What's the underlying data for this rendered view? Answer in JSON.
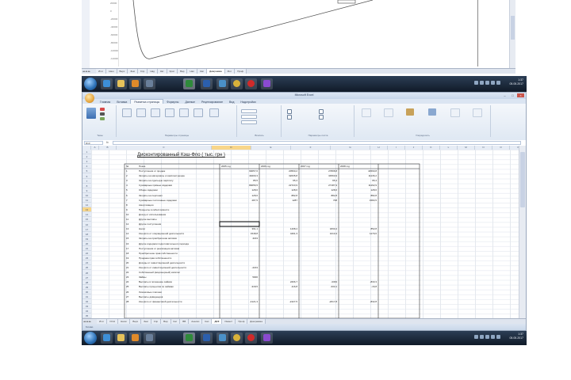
{
  "top_window": {
    "y_axis_labels": [
      "20000",
      "0",
      "-20000",
      "-40000",
      "-60000",
      "-80000",
      "-100000",
      "-120000"
    ],
    "tabs": [
      "Итог",
      "Наш",
      "Верх",
      "Зем",
      "Спр",
      "Над",
      "Кат",
      "Крат",
      "Вар",
      "Нал",
      "Кап",
      "Диаграмма",
      "Мот",
      "Проф"
    ],
    "active_tab": "Диаграмма"
  },
  "window": {
    "title": "Microsoft Excel",
    "menu_tabs": [
      "Главная",
      "Вставка",
      "Разметка страницы",
      "Формулы",
      "Данные",
      "Рецензирование",
      "Вид",
      "Надстройки"
    ],
    "active_menu_tab": "Разметка страницы",
    "ribbon_groups": [
      "Темы",
      "Параметры страницы",
      "Вписать",
      "Параметры листа",
      "Упорядочить"
    ],
    "name_box": "D13",
    "fx": "fx",
    "column_headers": [
      "A",
      "B",
      "C",
      "D",
      "E",
      "F",
      "G",
      "H",
      "I",
      "J",
      "K",
      "L",
      "M",
      "N",
      "O",
      "P"
    ],
    "sheet_title": "Дисконтированный Кэш-Фло ( тыс. грн )",
    "year_headers": [
      "2005 год",
      "2006 год",
      "2007 год",
      "2008 год"
    ],
    "rows": [
      {
        "n": "1",
        "label": "Поступления от продаж",
        "v": [
          "99057,6",
          "20560,2",
          "27808,8",
          "44590,8"
        ]
      },
      {
        "n": "2",
        "label": "Затраты на материалы и комплектующие",
        "v": [
          "49200,3",
          "32635,8",
          "34560,9",
          "11136,2"
        ]
      },
      {
        "n": "3",
        "label": "Затраты на сдельную зарплату",
        "v": [
          "85,5",
          "95,4",
          "95,4",
          "95,4"
        ]
      },
      {
        "n": "4",
        "label": "Суммарные прямые издержки",
        "v": [
          "89056,5",
          "22723,9",
          "27187,9",
          "11162,9"
        ]
      },
      {
        "n": "5",
        "label": "Общие издержки",
        "v": [
          "128,6",
          "128,6",
          "128,6",
          "128,6"
        ]
      },
      {
        "n": "6",
        "label": "Затраты на персонал",
        "v": [
          "128,6",
          "882,8",
          "882,8",
          "882,8"
        ]
      },
      {
        "n": "7",
        "label": "Суммарные постоянные издержки",
        "v": [
          "287,5",
          "1287",
          "708",
          "1583,5"
        ]
      },
      {
        "n": "8",
        "label": "Амортизация",
        "v": [
          "",
          "",
          "",
          ""
        ]
      },
      {
        "n": "9",
        "label": "Проценты в себестоимости",
        "v": [
          "",
          "",
          "",
          ""
        ]
      },
      {
        "n": "10",
        "label": "Доход от использования",
        "v": [
          "",
          "",
          "",
          ""
        ]
      },
      {
        "n": "11",
        "label": "Другие выплаты",
        "v": [
          "",
          "",
          "",
          ""
        ]
      },
      {
        "n": "12",
        "label": "Другие поступления",
        "v": [
          "",
          "",
          "",
          ""
        ]
      },
      {
        "n": "13",
        "label": "Налог",
        "v": [
          "391,1",
          "1408,4",
          "1830,4",
          "852,8"
        ]
      },
      {
        "n": "14",
        "label": "Кэш-фло от операционной деятельности",
        "v": [
          "1548,8",
          "4491,3",
          "1010,3",
          "1179,6"
        ]
      },
      {
        "n": "15",
        "label": "Затраты на приобретение активов",
        "v": [
          "4163",
          "",
          "",
          ""
        ]
      },
      {
        "n": "16",
        "label": "Другие издержки подготовительного периода",
        "v": [
          "",
          "",
          "",
          ""
        ]
      },
      {
        "n": "17",
        "label": "Поступления от реализации активов",
        "v": [
          "",
          "",
          "",
          ""
        ]
      },
      {
        "n": "18",
        "label": "Приобретение прав собственности",
        "v": [
          "",
          "",
          "",
          ""
        ]
      },
      {
        "n": "19",
        "label": "Продажа прав собственности",
        "v": [
          "",
          "",
          "",
          ""
        ]
      },
      {
        "n": "20",
        "label": "Доходы от инвестиционной деятельности",
        "v": [
          "",
          "",
          "",
          ""
        ]
      },
      {
        "n": "21",
        "label": "Кэш-фло от инвестиционной деятельности",
        "v": [
          "-4163",
          "",
          "",
          ""
        ]
      },
      {
        "n": "22",
        "label": "Собственный (акционерный) капитал",
        "v": [
          "",
          "",
          "",
          ""
        ]
      },
      {
        "n": "23",
        "label": "Займы",
        "v": [
          "5000",
          "",
          "",
          ""
        ]
      },
      {
        "n": "24",
        "label": "Выплаты в погашение займов",
        "v": [
          "",
          "2266,7",
          "-3333",
          "-833,3"
        ]
      },
      {
        "n": "25",
        "label": "Выплаты процентов по займам",
        "v": [
          "-318,5",
          "-116,8",
          "-333,1",
          "-16,8"
        ]
      },
      {
        "n": "26",
        "label": "Лизинговые платежи",
        "v": [
          "",
          "",
          "",
          ""
        ]
      },
      {
        "n": "27",
        "label": "Выплаты дивидендов",
        "v": [
          "",
          "",
          "",
          ""
        ]
      },
      {
        "n": "28",
        "label": "Кэш-фло от финансовой деятельности",
        "v": [
          "-4121,3",
          "-2427,5",
          "-2617,8",
          "-832,8"
        ]
      }
    ],
    "sheet_tabs": [
      "Итог",
      "ОСН",
      "Налог",
      "Верх",
      "Зем",
      "Спр",
      "Вар",
      "Кат",
      "ВВ",
      "Анализ",
      "Кап",
      "ДКФ",
      "Инвест",
      "Проф",
      "Диаграмма"
    ],
    "active_sheet_tab": "ДКФ",
    "status": "Готово"
  },
  "taskbar": {
    "time": "1:37",
    "date": "05.05.2017"
  }
}
